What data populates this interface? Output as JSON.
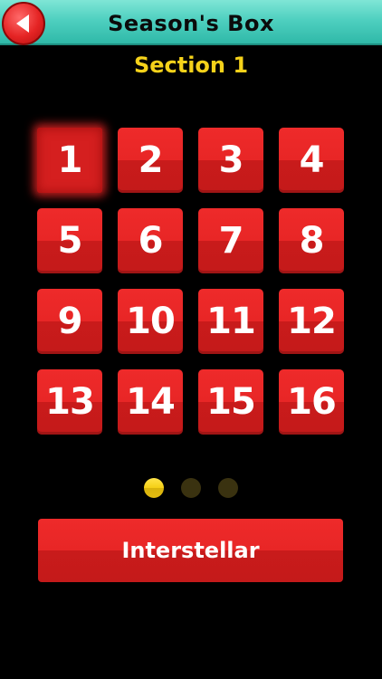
{
  "header": {
    "title": "Season's Box",
    "back_icon": "back-arrow-icon"
  },
  "section": {
    "title": "Section 1"
  },
  "levels": [
    "1",
    "2",
    "3",
    "4",
    "5",
    "6",
    "7",
    "8",
    "9",
    "10",
    "11",
    "12",
    "13",
    "14",
    "15",
    "16"
  ],
  "current_level": "1",
  "pager": {
    "total_pages": 3,
    "active_page": 1
  },
  "main_button": {
    "label": "Interstellar"
  },
  "colors": {
    "header": "#4fd0c0",
    "tile": "#e82626",
    "section_title": "#f5d21a",
    "dot_active": "#f5cf15",
    "dot_inactive": "#3a3210"
  }
}
